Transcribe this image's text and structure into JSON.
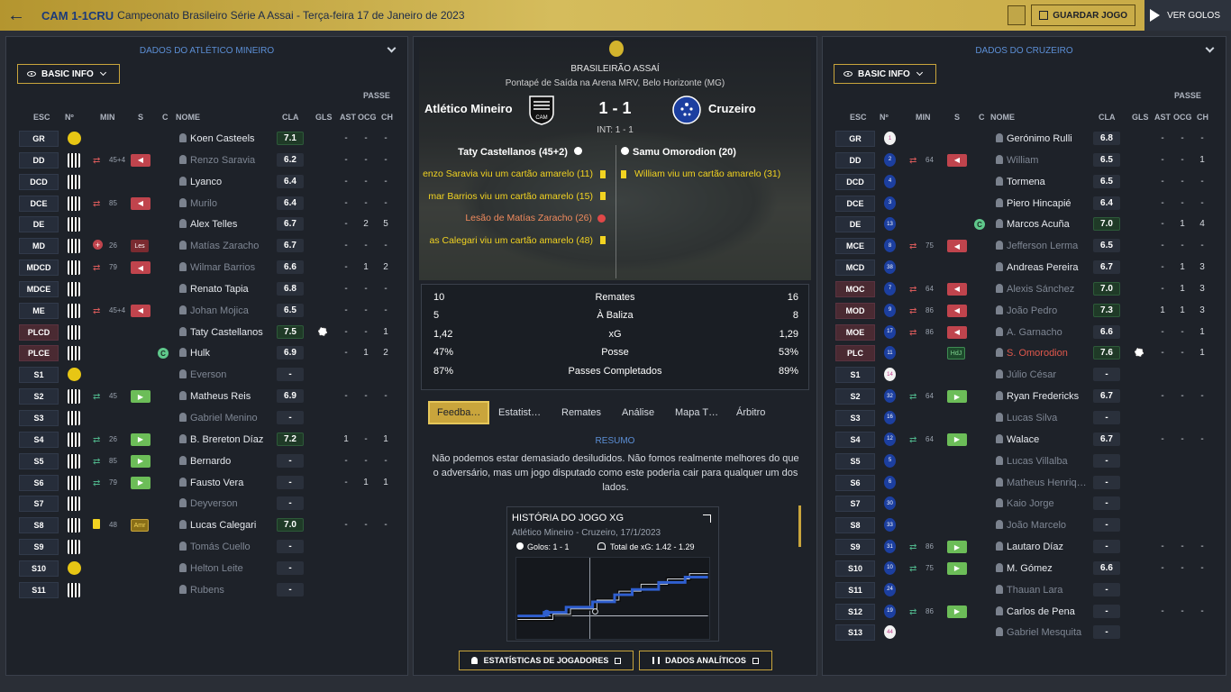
{
  "topbar": {
    "back_icon": "arrow-left-icon",
    "score": "CAM 1-1CRU",
    "competition": "Campeonato Brasileiro Série A Assai - Terça-feira 17 de Janeiro de 2023",
    "save": "GUARDAR JOGO",
    "watch": "VER GOLOS"
  },
  "left": {
    "title": "DADOS DO ATLÉTICO MINEIRO",
    "basic": "BASIC INFO",
    "passe": "PASSE",
    "headers": {
      "pos": "ESC",
      "num": "Nº",
      "min": "MIN",
      "s": "S",
      "c": "C",
      "name": "NOME",
      "rating": "CLA",
      "gls": "GLS",
      "ast": "AST",
      "ocg": "OCG",
      "ch": "CH"
    },
    "players": [
      {
        "pos": "GR",
        "kit": "yel",
        "name": "Koen Casteels",
        "rating": "7.1",
        "good": true,
        "gls": "",
        "ast": "-",
        "ocg": "-",
        "ch": "-"
      },
      {
        "pos": "DD",
        "kit": "stripe",
        "sub": "out",
        "min": "45+4",
        "badge": "out",
        "name": "Renzo Saravia",
        "dim": true,
        "rating": "6.2",
        "ast": "-",
        "ocg": "-",
        "ch": "-"
      },
      {
        "pos": "DCD",
        "kit": "stripe",
        "name": "Lyanco",
        "rating": "6.4",
        "ast": "-",
        "ocg": "-",
        "ch": "-"
      },
      {
        "pos": "DCE",
        "kit": "stripe",
        "sub": "out",
        "min": "85",
        "badge": "out",
        "name": "Murilo",
        "dim": true,
        "rating": "6.4",
        "ast": "-",
        "ocg": "-",
        "ch": "-"
      },
      {
        "pos": "DE",
        "kit": "stripe",
        "name": "Alex Telles",
        "rating": "6.7",
        "ast": "-",
        "ocg": "2",
        "ch": "5"
      },
      {
        "pos": "MD",
        "kit": "stripe",
        "inj": true,
        "min": "26",
        "badge": "les",
        "badge_text": "Les",
        "name": "Matías Zaracho",
        "dim": true,
        "rating": "6.7",
        "ast": "-",
        "ocg": "-",
        "ch": "-"
      },
      {
        "pos": "MDCD",
        "kit": "stripe",
        "sub": "out",
        "min": "79",
        "badge": "out",
        "name": "Wilmar Barrios",
        "dim": true,
        "rating": "6.6",
        "ast": "-",
        "ocg": "1",
        "ch": "2"
      },
      {
        "pos": "MDCE",
        "kit": "stripe",
        "name": "Renato Tapia",
        "rating": "6.8",
        "ast": "-",
        "ocg": "-",
        "ch": "-"
      },
      {
        "pos": "ME",
        "kit": "stripe",
        "sub": "out",
        "min": "45+4",
        "badge": "out",
        "name": "Johan Mojica",
        "dim": true,
        "rating": "6.5",
        "ast": "-",
        "ocg": "-",
        "ch": "-"
      },
      {
        "pos": "PLCD",
        "red": true,
        "kit": "stripe",
        "name": "Taty Castellanos",
        "rating": "7.5",
        "good": true,
        "goal": true,
        "ast": "-",
        "ocg": "-",
        "ch": "1"
      },
      {
        "pos": "PLCE",
        "red": true,
        "kit": "stripe",
        "captain": true,
        "name": "Hulk",
        "rating": "6.9",
        "ast": "-",
        "ocg": "1",
        "ch": "2"
      },
      {
        "pos": "S1",
        "kit": "yel",
        "name": "Everson",
        "dim": true,
        "rating": "-"
      },
      {
        "pos": "S2",
        "kit": "stripe",
        "sub": "in",
        "min": "45",
        "badge": "in",
        "name": "Matheus Reis",
        "rating": "6.9",
        "ast": "-",
        "ocg": "-",
        "ch": "-"
      },
      {
        "pos": "S3",
        "kit": "stripe",
        "name": "Gabriel Menino",
        "dim": true,
        "rating": "-"
      },
      {
        "pos": "S4",
        "kit": "stripe",
        "sub": "in",
        "min": "26",
        "badge": "in",
        "name": "B. Brereton Díaz",
        "rating": "7.2",
        "good": true,
        "ast": "1",
        "ocg": "-",
        "ch": "1"
      },
      {
        "pos": "S5",
        "kit": "stripe",
        "sub": "in",
        "min": "85",
        "badge": "in",
        "name": "Bernardo",
        "rating": "-",
        "ast": "-",
        "ocg": "-",
        "ch": "-"
      },
      {
        "pos": "S6",
        "kit": "stripe",
        "sub": "in",
        "min": "79",
        "badge": "in",
        "name": "Fausto Vera",
        "rating": "-",
        "ast": "-",
        "ocg": "1",
        "ch": "1"
      },
      {
        "pos": "S7",
        "kit": "stripe",
        "name": "Deyverson",
        "dim": true,
        "rating": "-"
      },
      {
        "pos": "S8",
        "kit": "stripe",
        "yc": true,
        "min": "48",
        "badge": "amr",
        "badge_text": "Amr",
        "name": "Lucas Calegari",
        "rating": "7.0",
        "good": true,
        "ast": "-",
        "ocg": "-",
        "ch": "-"
      },
      {
        "pos": "S9",
        "kit": "stripe",
        "name": "Tomás Cuello",
        "dim": true,
        "rating": "-"
      },
      {
        "pos": "S10",
        "kit": "yel",
        "name": "Helton Leite",
        "dim": true,
        "rating": "-"
      },
      {
        "pos": "S11",
        "kit": "stripe",
        "name": "Rubens",
        "dim": true,
        "rating": "-"
      }
    ]
  },
  "right": {
    "title": "DADOS DO CRUZEIRO",
    "basic": "BASIC INFO",
    "passe": "PASSE",
    "headers": {
      "pos": "ESC",
      "num": "Nº",
      "min": "MIN",
      "s": "S",
      "c": "C",
      "name": "NOME",
      "rating": "CLA",
      "gls": "GLS",
      "ast": "AST",
      "ocg": "OCG",
      "ch": "CH"
    },
    "players": [
      {
        "pos": "GR",
        "kit": "white",
        "num": "1",
        "name": "Gerónimo Rulli",
        "rating": "6.8",
        "ast": "-",
        "ocg": "-",
        "ch": "-"
      },
      {
        "pos": "DD",
        "kit": "blue",
        "num": "2",
        "sub": "out",
        "min": "64",
        "badge": "out",
        "name": "William",
        "dim": true,
        "rating": "6.5",
        "ast": "-",
        "ocg": "-",
        "ch": "1"
      },
      {
        "pos": "DCD",
        "kit": "blue",
        "num": "4",
        "name": "Tormena",
        "rating": "6.5",
        "ast": "-",
        "ocg": "-",
        "ch": "-"
      },
      {
        "pos": "DCE",
        "kit": "blue",
        "num": "3",
        "name": "Piero Hincapié",
        "rating": "6.4",
        "ast": "-",
        "ocg": "-",
        "ch": "-"
      },
      {
        "pos": "DE",
        "kit": "blue",
        "num": "13",
        "captain": true,
        "name": "Marcos Acuña",
        "rating": "7.0",
        "good": true,
        "ast": "-",
        "ocg": "1",
        "ch": "4"
      },
      {
        "pos": "MCE",
        "kit": "blue",
        "num": "8",
        "sub": "out",
        "min": "75",
        "badge": "out",
        "name": "Jefferson Lerma",
        "dim": true,
        "rating": "6.5",
        "ast": "-",
        "ocg": "-",
        "ch": "-"
      },
      {
        "pos": "MCD",
        "kit": "blue",
        "num": "38",
        "name": "Andreas Pereira",
        "rating": "6.7",
        "ast": "-",
        "ocg": "1",
        "ch": "3"
      },
      {
        "pos": "MOC",
        "red": true,
        "kit": "blue",
        "num": "7",
        "sub": "out",
        "min": "64",
        "badge": "out",
        "name": "Alexis Sánchez",
        "dim": true,
        "rating": "7.0",
        "good": true,
        "ast": "-",
        "ocg": "1",
        "ch": "3"
      },
      {
        "pos": "MOD",
        "red": true,
        "kit": "blue",
        "num": "9",
        "sub": "out",
        "min": "86",
        "badge": "out",
        "name": "João Pedro",
        "dim": true,
        "rating": "7.3",
        "good": true,
        "ast": "1",
        "ocg": "1",
        "ch": "3"
      },
      {
        "pos": "MOE",
        "red": true,
        "kit": "blue",
        "num": "17",
        "sub": "out",
        "min": "86",
        "badge": "out",
        "name": "A. Garnacho",
        "dim": true,
        "rating": "6.6",
        "ast": "-",
        "ocg": "-",
        "ch": "1"
      },
      {
        "pos": "PLC",
        "red": true,
        "kit": "blue",
        "num": "11",
        "badge": "hdj",
        "badge_text": "HdJ",
        "name": "S. Omorodion",
        "redname": true,
        "rating": "7.6",
        "good": true,
        "goal": true,
        "ast": "-",
        "ocg": "-",
        "ch": "1"
      },
      {
        "pos": "S1",
        "kit": "white",
        "num": "14",
        "name": "Júlio César",
        "dim": true,
        "rating": "-"
      },
      {
        "pos": "S2",
        "kit": "blue",
        "num": "32",
        "sub": "in",
        "min": "64",
        "badge": "in",
        "name": "Ryan Fredericks",
        "rating": "6.7",
        "ast": "-",
        "ocg": "-",
        "ch": "-"
      },
      {
        "pos": "S3",
        "kit": "blue",
        "num": "16",
        "name": "Lucas Silva",
        "dim": true,
        "rating": "-"
      },
      {
        "pos": "S4",
        "kit": "blue",
        "num": "12",
        "sub": "in",
        "min": "64",
        "badge": "in",
        "name": "Walace",
        "rating": "6.7",
        "ast": "-",
        "ocg": "-",
        "ch": "-"
      },
      {
        "pos": "S5",
        "kit": "blue",
        "num": "5",
        "name": "Lucas Villalba",
        "dim": true,
        "rating": "-"
      },
      {
        "pos": "S6",
        "kit": "blue",
        "num": "6",
        "name": "Matheus Henriq…",
        "dim": true,
        "rating": "-"
      },
      {
        "pos": "S7",
        "kit": "blue",
        "num": "30",
        "name": "Kaio Jorge",
        "dim": true,
        "rating": "-"
      },
      {
        "pos": "S8",
        "kit": "blue",
        "num": "33",
        "name": "João Marcelo",
        "dim": true,
        "rating": "-"
      },
      {
        "pos": "S9",
        "kit": "blue",
        "num": "31",
        "sub": "in",
        "min": "86",
        "badge": "in",
        "name": "Lautaro Díaz",
        "rating": "-",
        "ast": "-",
        "ocg": "-",
        "ch": "-"
      },
      {
        "pos": "S10",
        "kit": "blue",
        "num": "10",
        "sub": "in",
        "min": "75",
        "badge": "in",
        "name": "M. Gómez",
        "rating": "6.6",
        "ast": "-",
        "ocg": "-",
        "ch": "-"
      },
      {
        "pos": "S11",
        "kit": "blue",
        "num": "24",
        "name": "Thauan Lara",
        "dim": true,
        "rating": "-"
      },
      {
        "pos": "S12",
        "kit": "blue",
        "num": "19",
        "sub": "in",
        "min": "86",
        "badge": "in",
        "name": "Carlos de Pena",
        "rating": "-",
        "ast": "-",
        "ocg": "-",
        "ch": "-"
      },
      {
        "pos": "S13",
        "kit": "white",
        "num": "44",
        "name": "Gabriel Mesquita",
        "dim": true,
        "rating": "-"
      }
    ]
  },
  "match": {
    "competition": "BRASILEIRÃO ASSAÍ",
    "venue": "Pontapé de Saída na Arena MRV, Belo Horizonte (MG)",
    "home": "Atlético Mineiro",
    "away": "Cruzeiro",
    "score": "1 - 1",
    "ht": "INT: 1 - 1",
    "home_scorer": "Taty Castellanos (45+2)",
    "away_scorer": "Samu Omorodion (20)",
    "home_events": [
      {
        "text": "enzo Saravia viu um cartão amarelo (11)",
        "type": "y"
      },
      {
        "text": "mar Barrios viu um cartão amarelo (15)",
        "type": "y"
      },
      {
        "text": "Lesão de Matías Zaracho (26)",
        "type": "r"
      },
      {
        "text": "as Calegari viu um cartão amarelo (48)",
        "type": "y"
      }
    ],
    "away_events": [
      {
        "text": "William viu um cartão amarelo (31)",
        "type": "y"
      }
    ]
  },
  "stats": [
    {
      "home": "10",
      "label": "Remates",
      "away": "16"
    },
    {
      "home": "5",
      "label": "À Baliza",
      "away": "8"
    },
    {
      "home": "1,42",
      "label": "xG",
      "away": "1,29"
    },
    {
      "home": "47%",
      "label": "Posse",
      "away": "53%"
    },
    {
      "home": "87%",
      "label": "Passes Completados",
      "away": "89%"
    }
  ],
  "tabs": [
    "Feedba…",
    "Estatist…",
    "Remates",
    "Análise",
    "Mapa T…",
    "Árbitro"
  ],
  "summary": {
    "title": "RESUMO",
    "text": "Não podemos estar demasiado desiludidos. Não fomos realmente melhores do que o adversário, mas um jogo disputado como este poderia cair para qualquer um dos lados."
  },
  "xg": {
    "title": "HISTÓRIA DO JOGO XG",
    "sub": "Atlético Mineiro - Cruzeiro, 17/1/2023",
    "goals": "Golos: 1 - 1",
    "total": "Total de xG: 1.42 - 1.29"
  },
  "buttons": {
    "players": "ESTATÍSTICAS DE JOGADORES",
    "analytics": "DADOS ANALÍTICOS"
  }
}
